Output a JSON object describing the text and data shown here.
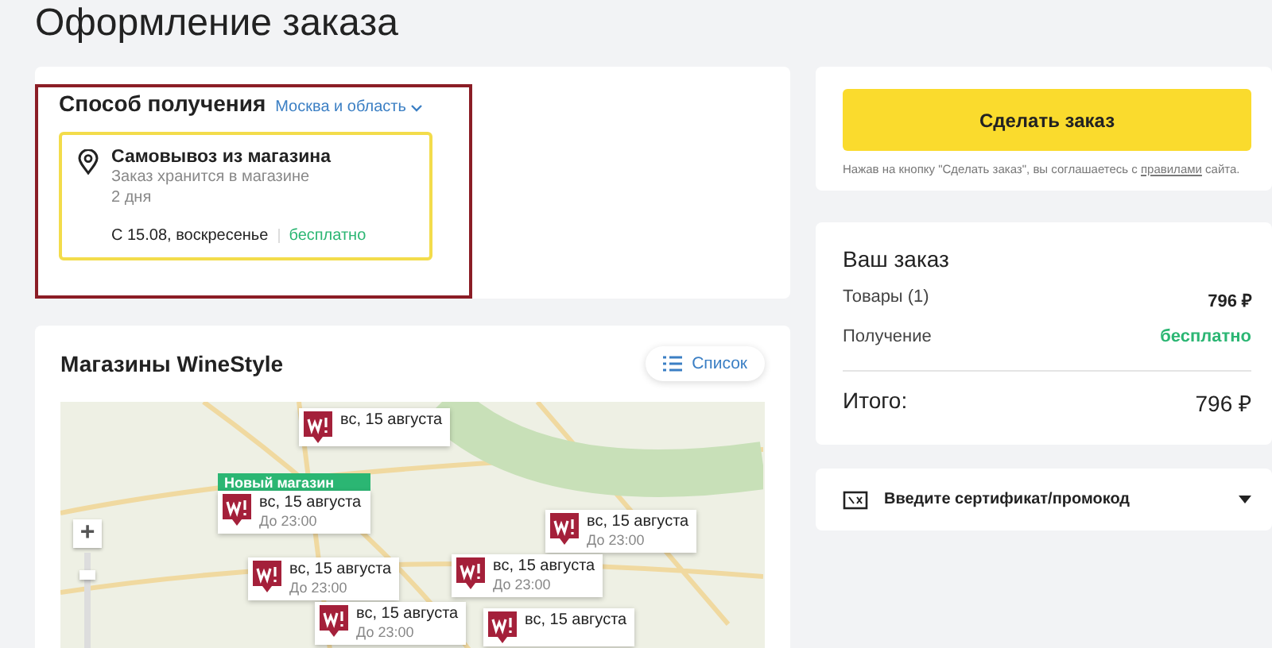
{
  "page_title": "Оформление заказа",
  "delivery": {
    "title": "Способ получения",
    "region": "Москва и область",
    "options": [
      {
        "title": "Самовывоз из магазина",
        "note": "Заказ хранится в магазине",
        "term": "2 дня",
        "date": "С 15.08, воскресенье",
        "price": "бесплатно",
        "selected": true
      }
    ]
  },
  "stores": {
    "title": "Магазины WineStyle",
    "list_button": "Список",
    "zoom_in": "+",
    "zoom_slider": {
      "level": 0.8
    },
    "markers": [
      {
        "date": "вс, 15 августа"
      },
      {
        "date": "вс, 15 августа",
        "time": "До 23:00",
        "badge": "Новый магазин"
      },
      {
        "date": "вс, 15 августа",
        "time": "До 23:00"
      },
      {
        "date": "вс, 15 августа",
        "time": "До 23:00"
      },
      {
        "date": "вс, 15 августа",
        "time": "До 23:00"
      },
      {
        "date": "вс, 15 августа",
        "time": "До 23:00"
      },
      {
        "date": "вс, 15 августа"
      }
    ]
  },
  "checkout": {
    "button": "Сделать заказ",
    "agreement": "Нажав на кнопку \"Сделать заказ\", вы соглашаетесь с",
    "agreement_link": "правилами",
    "agreement_end": "сайта."
  },
  "summary": {
    "title": "Ваш заказ",
    "rows": [
      {
        "label": "Товары (1)",
        "value": "796 ₽",
        "kind": "price"
      },
      {
        "label": "Получение",
        "value": "бесплатно",
        "kind": "free"
      }
    ],
    "total_label": "Итого:",
    "total_value": "796 ₽"
  },
  "promo": {
    "label": "Введите сертификат/промокод",
    "expanded": false
  }
}
